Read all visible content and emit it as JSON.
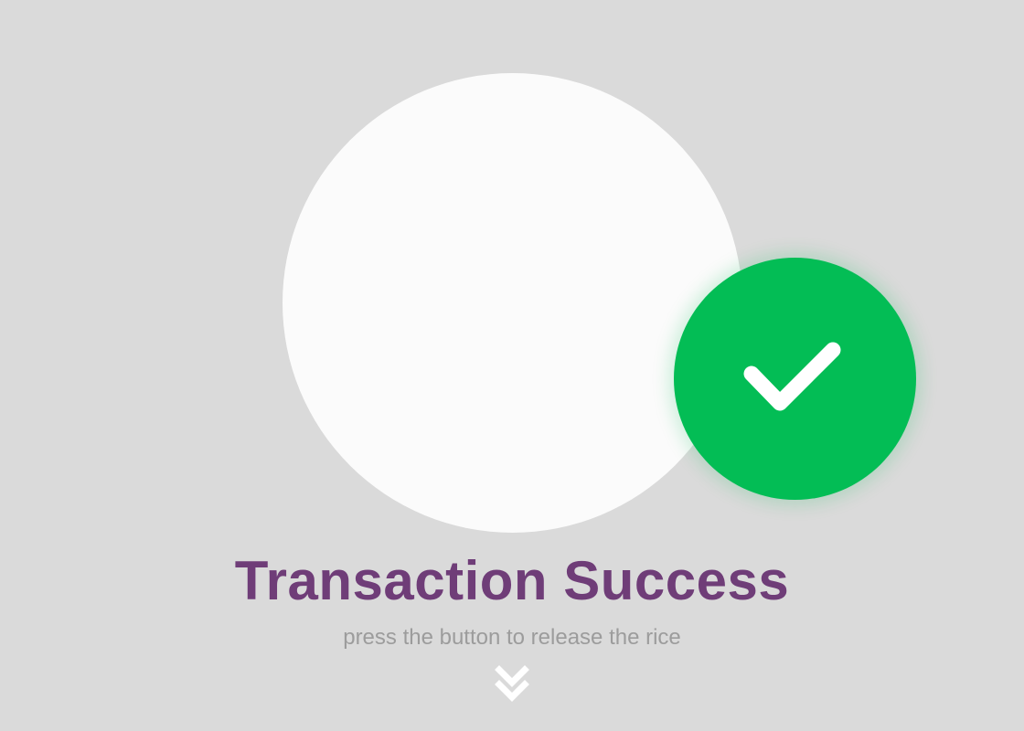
{
  "status": {
    "title": "Transaction Success",
    "subtitle": "press the button to release the rice"
  },
  "icons": {
    "status": "check-icon",
    "action": "double-chevron-down-icon"
  },
  "colors": {
    "background": "#dadada",
    "outer_circle": "#fbfbfb",
    "success": "#03bd55",
    "title": "#6f3d78",
    "subtitle": "#9c9c9c",
    "chevron": "#ffffff"
  }
}
